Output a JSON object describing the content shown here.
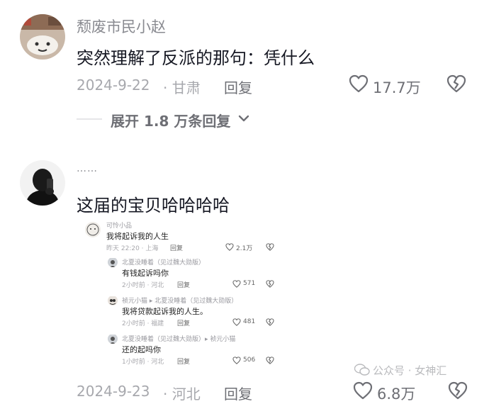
{
  "comments": [
    {
      "username": "颓废市民小赵",
      "text": "突然理解了反派的那句：凭什么",
      "date": "2024-9-22",
      "location": "· 甘肃",
      "reply_label": "回复",
      "likes": "17.7万",
      "expand_label": "展开 1.8 万条回复"
    },
    {
      "username": "……",
      "text": "这届的宝贝哈哈哈哈",
      "date": "2024-9-23",
      "location": "· 河北",
      "reply_label": "回复",
      "likes": "6.8万"
    }
  ],
  "embedded_screenshot": {
    "items": [
      {
        "username": "可怜小品",
        "text": "我将起诉我的人生",
        "meta": "昨天 22:20 · 上海",
        "reply": "回复",
        "likes": "2.1万"
      },
      {
        "username": "北夏没睡着（见过魏大勋版）",
        "text": "有钱起诉吗你",
        "meta": "2小时前 · 河北",
        "reply": "回复",
        "likes": "571"
      },
      {
        "username": "祯元小猫 ▸ 北夏没睡着（见过魏大勋版）",
        "text": "我将贷款起诉我的人生。",
        "meta": "2小时前 · 福建",
        "reply": "回复",
        "likes": "481"
      },
      {
        "username": "北夏没睡着（见过魏大勋版）▸ 祯元小猫",
        "text": "还的起吗你",
        "meta": "1小时前 · 河北",
        "reply": "回复",
        "likes": "506"
      }
    ]
  },
  "watermark": "公众号 · 女神汇",
  "colors": {
    "text": "#161823",
    "muted": "#a7a8ad",
    "icon": "#6e6f75"
  }
}
